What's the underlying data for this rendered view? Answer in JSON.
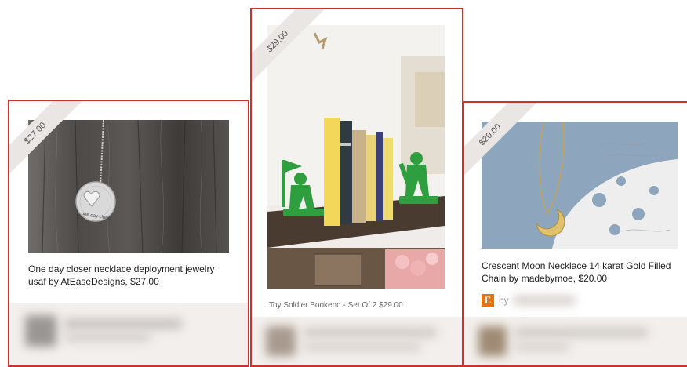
{
  "cards": [
    {
      "price_ribbon": "$27.00",
      "caption": "One day closer necklace deployment jewelry usaf by AtEaseDesigns, $27.00",
      "image_alt": "Silver disc necklace stamped one day closer on wooden background"
    },
    {
      "price_ribbon": "$29.00",
      "caption": "Toy Soldier Bookend - Set Of 2 $29.00",
      "image_alt": "Green toy soldier bookends holding books on a shelf"
    },
    {
      "price_ribbon": "$20.00",
      "caption": "Crescent Moon Necklace 14 karat Gold Filled Chain by madebymoe, $20.00",
      "shop_badge": "E",
      "by_label": "by",
      "image_alt": "Gold crescent moon pendant on gold chain over lace paper"
    }
  ],
  "colors": {
    "card_border": "#c9342a",
    "etsy_orange": "#e8730a"
  }
}
